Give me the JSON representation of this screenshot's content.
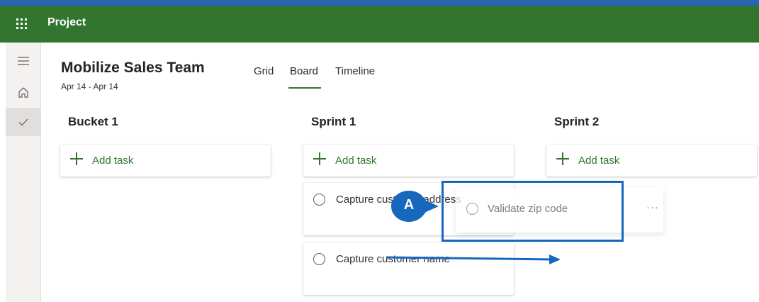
{
  "app": {
    "title": "Project"
  },
  "plan": {
    "name": "Mobilize Sales Team",
    "dates": "Apr 14 - Apr 14"
  },
  "tabs": [
    {
      "label": "Grid",
      "active": false
    },
    {
      "label": "Board",
      "active": true
    },
    {
      "label": "Timeline",
      "active": false
    }
  ],
  "buckets": [
    {
      "name": "Bucket 1",
      "add_label": "Add task"
    },
    {
      "name": "Sprint 1",
      "add_label": "Add task"
    },
    {
      "name": "Sprint 2",
      "add_label": "Add task"
    }
  ],
  "tasks": [
    {
      "title": "Capture customer address",
      "bucket": "Sprint 1"
    },
    {
      "title": "Capture customer name",
      "bucket": "Sprint 1"
    }
  ],
  "dragging_task": {
    "title": "Validate zip code",
    "more": "···"
  },
  "callout": {
    "label": "A"
  },
  "colors": {
    "brand": "#31752f",
    "accent": "#1668bd",
    "topbar_border": "#2a64b5"
  },
  "icons": {
    "waffle": "app-launcher-icon",
    "menu": "hamburger-icon",
    "home": "home-icon",
    "check": "checkmark-icon"
  }
}
